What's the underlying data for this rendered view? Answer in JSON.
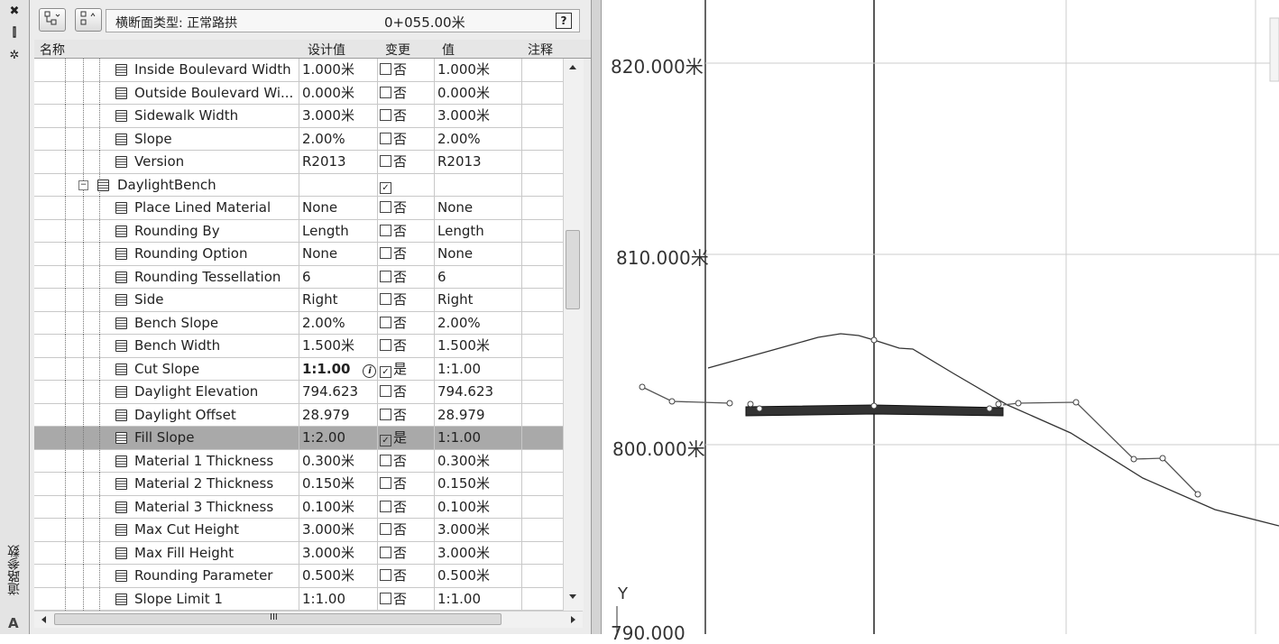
{
  "strip": {
    "close_glyph": "✖",
    "pin_glyph": "⫿",
    "settings_glyph": "✲",
    "vertical_title": "道路参数",
    "logo": "A"
  },
  "toolbar": {
    "type_label": "横断面类型: 正常路拱",
    "station": "0+055.00米",
    "help": "?"
  },
  "columns": {
    "name": "名称",
    "design_value": "设计值",
    "changed": "变更",
    "value": "值",
    "comment": "注释"
  },
  "rows": [
    {
      "name": "Inside Boulevard Width",
      "design": "1.000米",
      "chk": "",
      "changed": "否",
      "value": "1.000米"
    },
    {
      "name": "Outside Boulevard Wi...",
      "design": "0.000米",
      "chk": "",
      "changed": "否",
      "value": "0.000米"
    },
    {
      "name": "Sidewalk Width",
      "design": "3.000米",
      "chk": "",
      "changed": "否",
      "value": "3.000米"
    },
    {
      "name": "Slope",
      "design": "2.00%",
      "chk": "",
      "changed": "否",
      "value": "2.00%"
    },
    {
      "name": "Version",
      "design": "R2013",
      "chk": "",
      "changed": "否",
      "value": "R2013"
    },
    {
      "name": "DaylightBench",
      "design": "",
      "chk": "✓",
      "changed": "",
      "value": "",
      "group": true
    },
    {
      "name": "Place Lined Material",
      "design": "None",
      "chk": "",
      "changed": "否",
      "value": "None"
    },
    {
      "name": "Rounding By",
      "design": "Length",
      "chk": "",
      "changed": "否",
      "value": "Length"
    },
    {
      "name": "Rounding Option",
      "design": "None",
      "chk": "",
      "changed": "否",
      "value": "None"
    },
    {
      "name": "Rounding Tessellation",
      "design": "6",
      "chk": "",
      "changed": "否",
      "value": "6"
    },
    {
      "name": "Side",
      "design": "Right",
      "chk": "",
      "changed": "否",
      "value": "Right"
    },
    {
      "name": "Bench Slope",
      "design": "2.00%",
      "chk": "",
      "changed": "否",
      "value": "2.00%"
    },
    {
      "name": "Bench Width",
      "design": "1.500米",
      "chk": "",
      "changed": "否",
      "value": "1.500米"
    },
    {
      "name": "Cut Slope",
      "design": "1:1.00",
      "chk": "✓",
      "changed": "是",
      "value": "1:1.00",
      "bold": true,
      "info": "i"
    },
    {
      "name": "Daylight Elevation",
      "design": "794.623",
      "chk": "",
      "changed": "否",
      "value": "794.623"
    },
    {
      "name": "Daylight Offset",
      "design": "28.979",
      "chk": "",
      "changed": "否",
      "value": "28.979"
    },
    {
      "name": "Fill Slope",
      "design": "1:2.00",
      "chk": "✓",
      "changed": "是",
      "value": "1:1.00",
      "selected": true
    },
    {
      "name": "Material 1 Thickness",
      "design": "0.300米",
      "chk": "",
      "changed": "否",
      "value": "0.300米"
    },
    {
      "name": "Material 2 Thickness",
      "design": "0.150米",
      "chk": "",
      "changed": "否",
      "value": "0.150米"
    },
    {
      "name": "Material 3 Thickness",
      "design": "0.100米",
      "chk": "",
      "changed": "否",
      "value": "0.100米"
    },
    {
      "name": "Max Cut Height",
      "design": "3.000米",
      "chk": "",
      "changed": "否",
      "value": "3.000米"
    },
    {
      "name": "Max Fill Height",
      "design": "3.000米",
      "chk": "",
      "changed": "否",
      "value": "3.000米"
    },
    {
      "name": "Rounding Parameter",
      "design": "0.500米",
      "chk": "",
      "changed": "否",
      "value": "0.500米"
    },
    {
      "name": "Slope Limit 1",
      "design": "1:1.00",
      "chk": "",
      "changed": "否",
      "value": "1:1.00"
    }
  ],
  "scroll": {
    "h_thumb_glyph": "III",
    "v_thumb_glyph": "≡"
  },
  "view": {
    "elev_labels": [
      "820.000米",
      "810.000米",
      "800.000米",
      "790.000"
    ],
    "axis_y": "Y"
  }
}
